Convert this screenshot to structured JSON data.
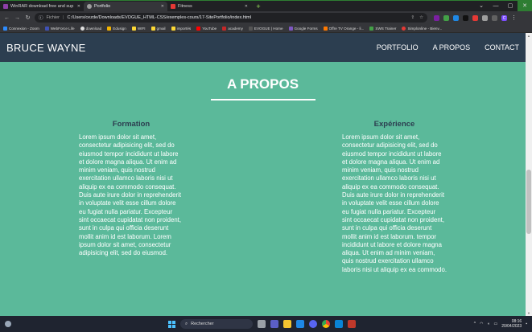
{
  "browser": {
    "tabs": [
      {
        "label": "WinRAR download free and sup",
        "active": false,
        "color": "#8e3fa8"
      },
      {
        "label": "Portfolio",
        "active": true,
        "color": "#9e9e9e"
      },
      {
        "label": "Fitness",
        "active": false,
        "color": "#e53935"
      }
    ],
    "address": {
      "prefix": "Fichier",
      "url": "C:/Users/cezde/Downloads/EVOGUE_HTML-CSS/exemples-cours/17-SitePortfolio/index.html"
    },
    "bookmarks": [
      {
        "label": "Connexion - Zoom",
        "color": "#2d8cff"
      },
      {
        "label": "WebForce Life",
        "color": "#3f51b5"
      },
      {
        "label": "download",
        "color": "#e0e0e0"
      },
      {
        "label": "Edusign",
        "color": "#f4b400"
      },
      {
        "label": "WIFI",
        "color": "#fdd835"
      },
      {
        "label": "gmail",
        "color": "#fdd835"
      },
      {
        "label": "importés",
        "color": "#fdd835"
      },
      {
        "label": "YouTube",
        "color": "#ff0000"
      },
      {
        "label": "academy",
        "color": "#c62828"
      },
      {
        "label": "EVOGUE | Home",
        "color": "#555555"
      },
      {
        "label": "Google Forms",
        "color": "#7e57c2"
      },
      {
        "label": "Offre TV Orange - li...",
        "color": "#ff7900"
      },
      {
        "label": "SWS Trainer",
        "color": "#43a047"
      },
      {
        "label": "Simplonline - Bienv...",
        "color": "#e53935"
      }
    ]
  },
  "site": {
    "brand": "BRUCE WAYNE",
    "menu": [
      "PORTFOLIO",
      "A PROPOS",
      "CONTACT"
    ],
    "section_title": "A PROPOS",
    "formation": {
      "heading": "Formation",
      "text": "Lorem ipsum dolor sit amet, consectetur adipisicing elit, sed do eiusmod tempor incididunt ut labore et dolore magna aliqua. Ut enim ad minim veniam, quis nostrud exercitation ullamco laboris nisi ut aliquip ex ea commodo consequat. Duis aute irure dolor in reprehenderit in voluptate velit esse cillum dolore eu fugiat nulla pariatur. Excepteur sint occaecat cupidatat non proident, sunt in culpa qui officia deserunt mollit anim id est laborum. Lorem ipsum dolor sit amet, consectetur adipisicing elit, sed do eiusmod."
    },
    "experience": {
      "heading": "Expérience",
      "text": "Lorem ipsum dolor sit amet, consectetur adipisicing elit, sed do eiusmod tempor incididunt ut labore et dolore magna aliqua. Ut enim ad minim veniam, quis nostrud exercitation ullamco laboris nisi ut aliquip ex ea commodo consequat. Duis aute irure dolor in reprehenderit in voluptate velit esse cillum dolore eu fugiat nulla pariatur. Excepteur sint occaecat cupidatat non proident, sunt in culpa qui officia deserunt mollit anim id est laborum. tempor incididunt ut labore et dolore magna aliqua. Ut enim ad minim veniam, quis nostrud exercitation ullamco laboris nisi ut aliquip ex ea commodo."
    },
    "colors": {
      "background": "#5bb99a",
      "navbar": "#2c3e50",
      "heading": "#2c3e50"
    }
  },
  "taskbar": {
    "search_placeholder": "Rechercher",
    "time": "08:16",
    "date": "20/04/2023"
  }
}
